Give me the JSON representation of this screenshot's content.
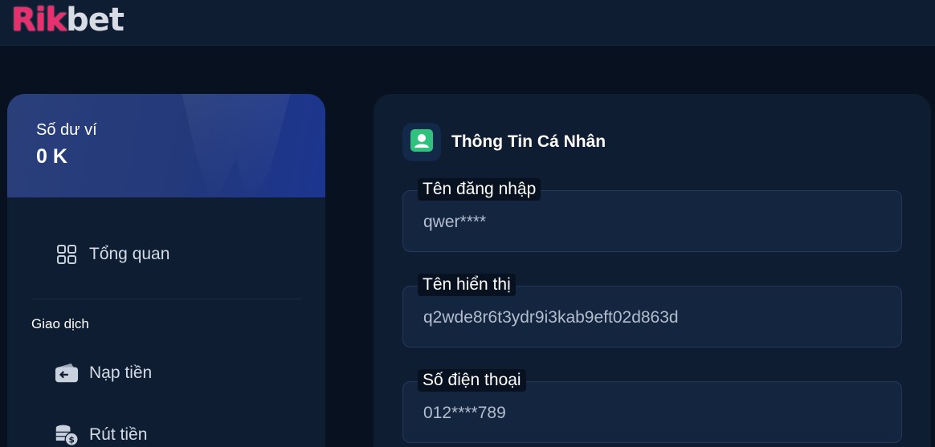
{
  "brand": {
    "part1": "Rik",
    "part2": "bet"
  },
  "wallet": {
    "label": "Số dư ví",
    "amount": "0 K"
  },
  "sidebar": {
    "overview": {
      "label": "Tổng quan",
      "icon": "grid-icon"
    },
    "section_title": "Giao dịch",
    "items": [
      {
        "label": "Nạp tiền",
        "icon": "wallet-icon"
      },
      {
        "label": "Rút tiền",
        "icon": "coins-icon"
      }
    ]
  },
  "profile": {
    "title": "Thông Tin Cá Nhân",
    "icon": "user-icon",
    "fields": [
      {
        "label": "Tên đăng nhập",
        "value": "qwer****"
      },
      {
        "label": "Tên hiển thị",
        "value": "q2wde8r6t3ydr9i3kab9eft02d863d"
      },
      {
        "label": "Số điện thoại",
        "value": "012****789"
      }
    ]
  },
  "colors": {
    "brand_pink": "#e8306e",
    "accent_green": "#2ec27e",
    "panel": "#0f1d33"
  }
}
